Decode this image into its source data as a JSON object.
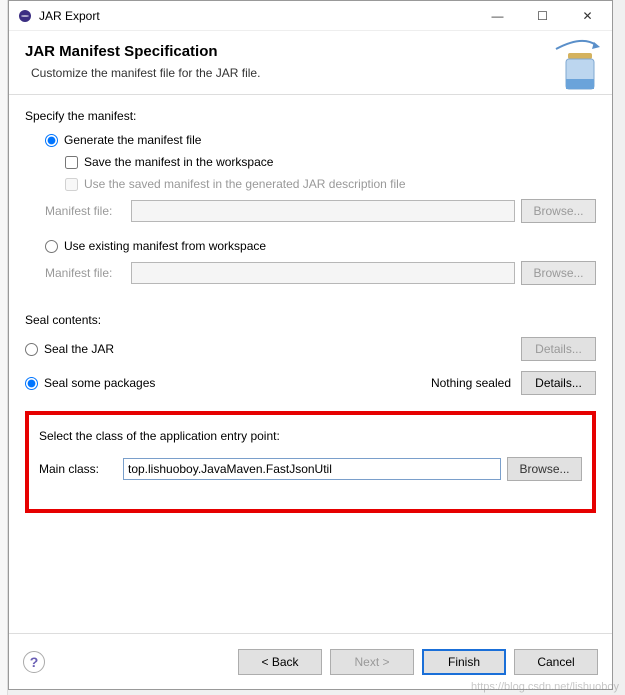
{
  "window": {
    "title": "JAR Export"
  },
  "header": {
    "title": "JAR Manifest Specification",
    "subtitle": "Customize the manifest file for the JAR file."
  },
  "manifest": {
    "section_label": "Specify the manifest:",
    "generate_label": "Generate the manifest file",
    "save_workspace_label": "Save the manifest in the workspace",
    "reuse_manifest_label": "Use the saved manifest in the generated JAR description file",
    "manifest_file_label": "Manifest file:",
    "use_existing_label": "Use existing manifest from workspace",
    "browse_label": "Browse..."
  },
  "seal": {
    "section_label": "Seal contents:",
    "seal_jar_label": "Seal the JAR",
    "seal_some_label": "Seal some packages",
    "nothing_sealed": "Nothing sealed",
    "details_label": "Details..."
  },
  "entry": {
    "section_label": "Select the class of the application entry point:",
    "main_class_label": "Main class:",
    "main_class_value": "top.lishuoboy.JavaMaven.FastJsonUtil",
    "browse_label": "Browse..."
  },
  "footer": {
    "back": "< Back",
    "next": "Next >",
    "finish": "Finish",
    "cancel": "Cancel"
  },
  "watermark": "https://blog.csdn.net/lishuoboy"
}
